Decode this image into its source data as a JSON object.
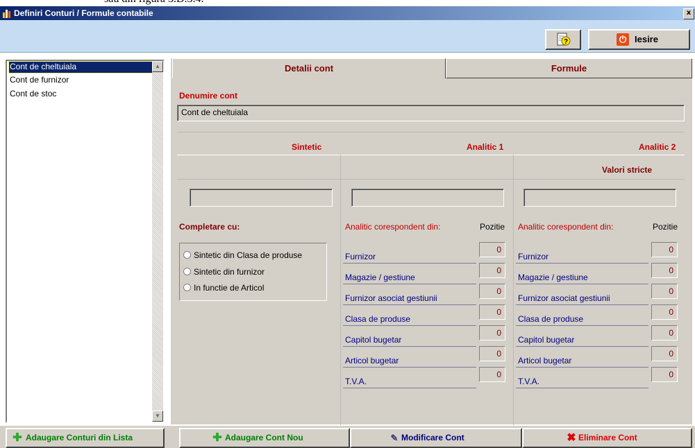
{
  "document_fragment": "sau din figura 3.D.3.4.",
  "window": {
    "title": "Definiri Conturi / Formule contabile",
    "close_glyph": "x"
  },
  "toolbar": {
    "help_icon": "help-document-icon",
    "exit_label": "Iesire",
    "exit_icon": "power-icon"
  },
  "accounts_list": [
    "Cont de cheltuiala",
    "Cont de furnizor",
    "Cont de stoc"
  ],
  "tabs": [
    "Detalii cont",
    "Formule"
  ],
  "details": {
    "account_name_label": "Denumire cont",
    "account_name_value": "Cont de cheltuiala",
    "col_sintetic": "Sintetic",
    "col_analitic1": "Analitic 1",
    "col_analitic2": "Analitic 2",
    "valori_stricte": "Valori stricte",
    "completare_label": "Completare cu:",
    "radio_options": [
      "Sintetic din Clasa de produse",
      "Sintetic din furnizor",
      "In functie de Articol"
    ],
    "analitic_header": "Analitic corespondent din:",
    "pozitie_header": "Pozitie",
    "analitic_rows": [
      {
        "label": "Furnizor",
        "a1": "0",
        "a2": "0"
      },
      {
        "label": "Magazie / gestiune",
        "a1": "0",
        "a2": "0"
      },
      {
        "label": "Furnizor asociat gestiunii",
        "a1": "0",
        "a2": "0"
      },
      {
        "label": "Clasa de produse",
        "a1": "0",
        "a2": "0"
      },
      {
        "label": "Capitol bugetar",
        "a1": "0",
        "a2": "0"
      },
      {
        "label": "Articol bugetar",
        "a1": "0",
        "a2": "0"
      },
      {
        "label": "T.V.A.",
        "a1": "0",
        "a2": "0"
      }
    ]
  },
  "bottom_buttons": {
    "add_from_list": "Adaugare Conturi din Lista",
    "add_new": "Adaugare Cont Nou",
    "modify": "Modificare Cont",
    "delete": "Eliminare Cont"
  },
  "colors": {
    "title_start": "#0a246a",
    "title_end": "#a6caf0",
    "toolbar_bg": "#c6dcf2",
    "panel_bg": "#d4d0c8",
    "label_red": "#c00000",
    "add_green": "#2fa82f",
    "delete_red": "#e00000"
  }
}
